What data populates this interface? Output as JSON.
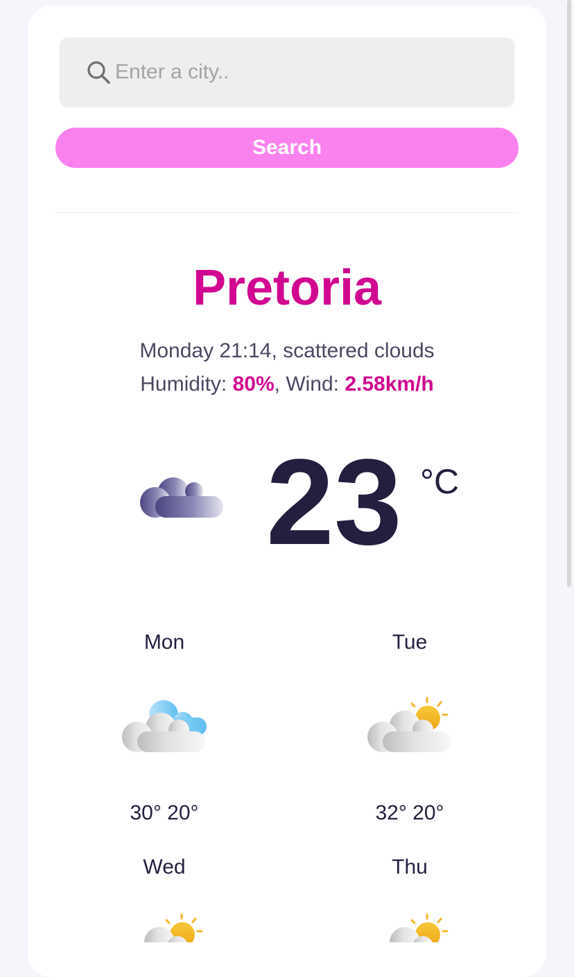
{
  "search": {
    "placeholder": "Enter a city..",
    "value": "",
    "button_label": "Search",
    "icon": "search-icon"
  },
  "current": {
    "city": "Pretoria",
    "day_time": "Monday 21:14",
    "description": "scattered clouds",
    "humidity_label": "Humidity: ",
    "humidity": "80%",
    "wind_label": "Wind: ",
    "wind": "2.58km/h",
    "temperature": "23",
    "unit": "°C",
    "icon": "scattered-clouds-night-icon"
  },
  "forecast": [
    {
      "day": "Mon",
      "range": "30° 20°",
      "icon": "cloudy-icon"
    },
    {
      "day": "Tue",
      "range": "32° 20°",
      "icon": "partly-sunny-icon"
    },
    {
      "day": "Wed",
      "range": "",
      "icon": "partly-sunny-icon"
    },
    {
      "day": "Thu",
      "range": "",
      "icon": "partly-sunny-icon"
    }
  ],
  "colors": {
    "accent": "#d1088f",
    "button": "#fa82ef",
    "text_dark": "#231f3e",
    "text_muted": "#4a4860",
    "input_bg": "#eeeeee"
  }
}
